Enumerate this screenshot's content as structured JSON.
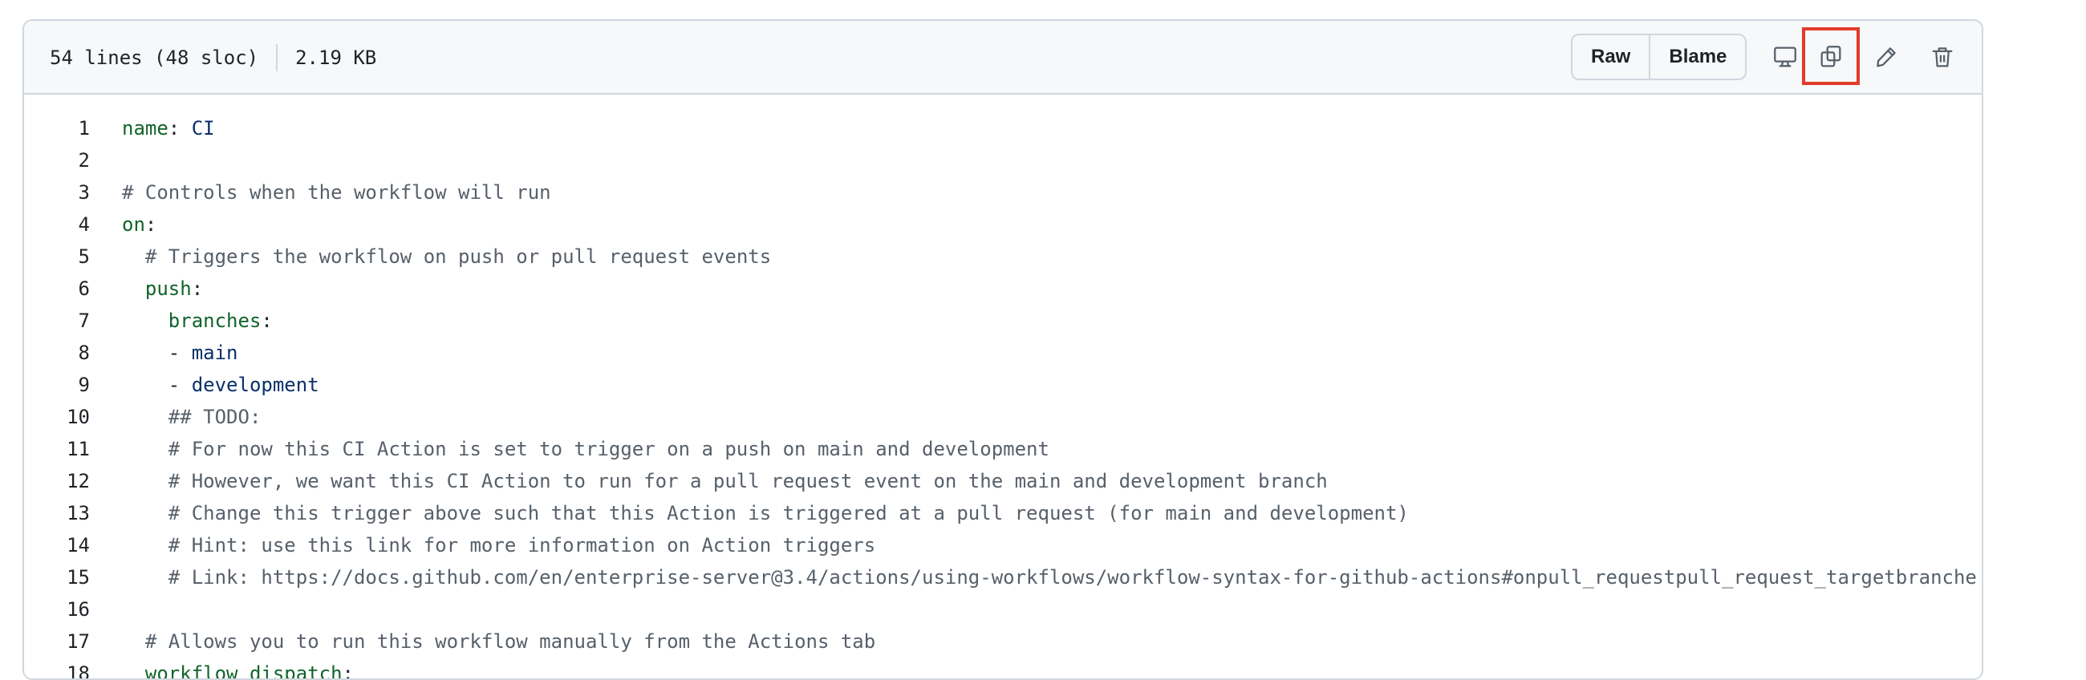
{
  "file_header": {
    "lines_info": "54 lines (48 sloc)",
    "size": "2.19 KB",
    "raw_label": "Raw",
    "blame_label": "Blame"
  },
  "icons": {
    "display": "desktop-icon",
    "copy": "copy-icon",
    "edit": "pencil-icon",
    "delete": "trash-icon"
  },
  "colors": {
    "key": "#116329",
    "value": "#0a3069",
    "comment": "#57606a",
    "highlight": "#e03c2a"
  },
  "code_lines": [
    {
      "num": "1",
      "indent": "",
      "key": "name",
      "sep": ": ",
      "value": "CI",
      "comment": ""
    },
    {
      "num": "2",
      "indent": "",
      "key": "",
      "sep": "",
      "value": "",
      "comment": ""
    },
    {
      "num": "3",
      "indent": "",
      "key": "",
      "sep": "",
      "value": "",
      "comment": "# Controls when the workflow will run"
    },
    {
      "num": "4",
      "indent": "",
      "key": "on",
      "sep": ":",
      "value": "",
      "comment": ""
    },
    {
      "num": "5",
      "indent": "  ",
      "key": "",
      "sep": "",
      "value": "",
      "comment": "# Triggers the workflow on push or pull request events"
    },
    {
      "num": "6",
      "indent": "  ",
      "key": "push",
      "sep": ":",
      "value": "",
      "comment": ""
    },
    {
      "num": "7",
      "indent": "    ",
      "key": "branches",
      "sep": ":",
      "value": "",
      "comment": ""
    },
    {
      "num": "8",
      "indent": "    ",
      "key": "",
      "sep": "- ",
      "value": "main",
      "comment": ""
    },
    {
      "num": "9",
      "indent": "    ",
      "key": "",
      "sep": "- ",
      "value": "development",
      "comment": ""
    },
    {
      "num": "10",
      "indent": "    ",
      "key": "",
      "sep": "",
      "value": "",
      "comment": "## TODO:"
    },
    {
      "num": "11",
      "indent": "    ",
      "key": "",
      "sep": "",
      "value": "",
      "comment": "# For now this CI Action is set to trigger on a push on main and development"
    },
    {
      "num": "12",
      "indent": "    ",
      "key": "",
      "sep": "",
      "value": "",
      "comment": "# However, we want this CI Action to run for a pull request event on the main and development branch"
    },
    {
      "num": "13",
      "indent": "    ",
      "key": "",
      "sep": "",
      "value": "",
      "comment": "# Change this trigger above such that this Action is triggered at a pull request (for main and development)"
    },
    {
      "num": "14",
      "indent": "    ",
      "key": "",
      "sep": "",
      "value": "",
      "comment": "# Hint: use this link for more information on Action triggers"
    },
    {
      "num": "15",
      "indent": "    ",
      "key": "",
      "sep": "",
      "value": "",
      "comment": "# Link: https://docs.github.com/en/enterprise-server@3.4/actions/using-workflows/workflow-syntax-for-github-actions#onpull_requestpull_request_targetbranche"
    },
    {
      "num": "16",
      "indent": "",
      "key": "",
      "sep": "",
      "value": "",
      "comment": ""
    },
    {
      "num": "17",
      "indent": "  ",
      "key": "",
      "sep": "",
      "value": "",
      "comment": "# Allows you to run this workflow manually from the Actions tab"
    },
    {
      "num": "18",
      "indent": "  ",
      "key": "workflow_dispatch",
      "sep": ":",
      "value": "",
      "comment": ""
    }
  ]
}
